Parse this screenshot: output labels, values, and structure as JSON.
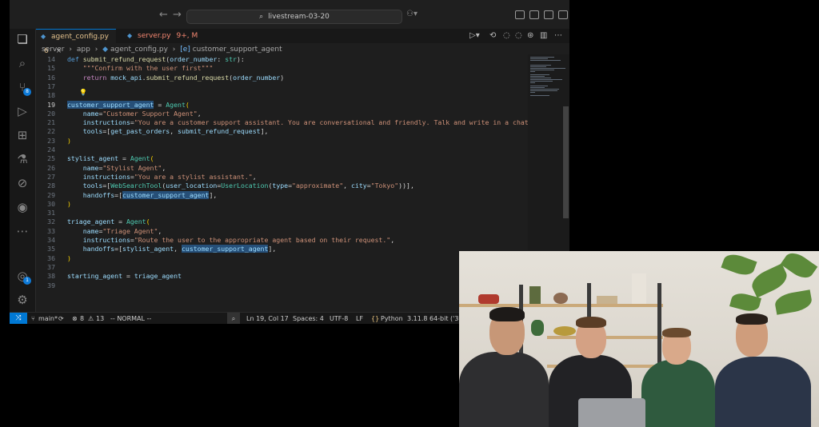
{
  "titlebar": {
    "search_text": "livestream-03-20"
  },
  "tabs": [
    {
      "label": "agent_config.py",
      "badge": "6"
    },
    {
      "label": "server.py",
      "badge": "9+, M"
    }
  ],
  "breadcrumb": [
    "server",
    "app",
    "agent_config.py",
    "customer_support_agent"
  ],
  "activity_badges": {
    "source_control": "8",
    "accounts": "1"
  },
  "code_lines": [
    {
      "n": "14",
      "html": "<span class=\"k\">def</span> <span class=\"f\">submit_refund_request</span>(<span class=\"v\">order_number</span>: <span class=\"c\">str</span>):"
    },
    {
      "n": "15",
      "html": "    <span class=\"s\">\"\"\"Confirm with the user first\"\"\"</span>"
    },
    {
      "n": "16",
      "html": "    <span class=\"kc\">return</span> <span class=\"v\">mock_api</span>.<span class=\"f\">submit_refund_request</span>(<span class=\"v\">order_number</span>)"
    },
    {
      "n": "17",
      "html": ""
    },
    {
      "n": "18",
      "html": ""
    },
    {
      "n": "19",
      "html": "<span class=\"v hl\">customer_support_agent</span> = <span class=\"c\">Agent</span><span class=\"p\">(</span>"
    },
    {
      "n": "20",
      "html": "    <span class=\"v\">name</span>=<span class=\"s\">\"Customer Support Agent\"</span>,"
    },
    {
      "n": "21",
      "html": "    <span class=\"v\">instructions</span>=<span class=\"s\">\"You are a customer support assistant. You are conversational and friendly. Talk and write in a chat style wit</span>"
    },
    {
      "n": "22",
      "html": "    <span class=\"v\">tools</span>=[<span class=\"v\">get_past_orders</span>, <span class=\"v\">submit_refund_request</span>],"
    },
    {
      "n": "23",
      "html": "<span class=\"p\">)</span>"
    },
    {
      "n": "24",
      "html": ""
    },
    {
      "n": "25",
      "html": "<span class=\"v\">stylist_agent</span> = <span class=\"c\">Agent</span><span class=\"p\">(</span>"
    },
    {
      "n": "26",
      "html": "    <span class=\"v\">name</span>=<span class=\"s\">\"Stylist Agent\"</span>,"
    },
    {
      "n": "27",
      "html": "    <span class=\"v\">instructions</span>=<span class=\"s\">\"You are a stylist assistant.\"</span>,"
    },
    {
      "n": "28",
      "html": "    <span class=\"v\">tools</span>=[<span class=\"c\">WebSearchTool</span>(<span class=\"v\">user_location</span>=<span class=\"c\">UserLocation</span>(<span class=\"v\">type</span>=<span class=\"s\">\"approximate\"</span>, <span class=\"v\">city</span>=<span class=\"s\">\"Tokyo\"</span>))],"
    },
    {
      "n": "29",
      "html": "    <span class=\"v\">handoffs</span>=[<span class=\"v hl\">customer_support_agent</span>],"
    },
    {
      "n": "30",
      "html": "<span class=\"p\">)</span>"
    },
    {
      "n": "31",
      "html": ""
    },
    {
      "n": "32",
      "html": "<span class=\"v\">triage_agent</span> = <span class=\"c\">Agent</span><span class=\"p\">(</span>"
    },
    {
      "n": "33",
      "html": "    <span class=\"v\">name</span>=<span class=\"s\">\"Triage Agent\"</span>,"
    },
    {
      "n": "34",
      "html": "    <span class=\"v\">instructions</span>=<span class=\"s\">\"Route the user to the appropriate agent based on their request.\"</span>,"
    },
    {
      "n": "35",
      "html": "    <span class=\"v\">handoffs</span>=[<span class=\"v\">stylist_agent</span>, <span class=\"v hl\">customer_support_agent</span>],"
    },
    {
      "n": "36",
      "html": "<span class=\"p\">)</span>"
    },
    {
      "n": "37",
      "html": ""
    },
    {
      "n": "38",
      "html": "<span class=\"v\">starting_agent</span> = <span class=\"v\">triage_agent</span>"
    },
    {
      "n": "39",
      "html": ""
    }
  ],
  "current_line": "19",
  "status": {
    "branch": "main*",
    "errors": "8",
    "warnings": "13",
    "mode": "-- NORMAL --",
    "cursor": "Ln 19, Col 17",
    "spaces": "Spaces: 4",
    "encoding": "UTF-8",
    "eol": "LF",
    "language": "Python",
    "interpreter": "3.11.8 64-bit ('3.1"
  }
}
